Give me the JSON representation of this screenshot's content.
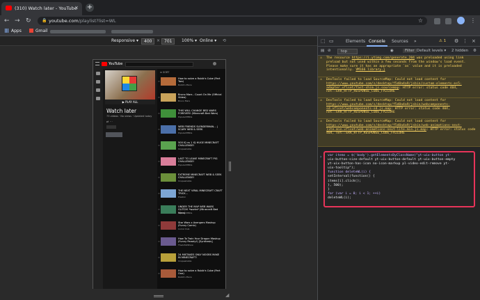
{
  "browser": {
    "tab_title": "(310) Watch later - YouTube",
    "tab_close": "×",
    "new_tab": "+",
    "back": "←",
    "forward": "→",
    "reload": "↻",
    "lock": "🔒",
    "url_host": "youtube.com",
    "url_path": "/playlist?list=WL",
    "star": "☆",
    "menu": "⋮"
  },
  "bookmarks": {
    "apps": "Apps",
    "gmail": "Gmail"
  },
  "device_toolbar": {
    "device": "Responsive ▾",
    "width": "400",
    "times": "×",
    "height": "701",
    "zoom": "100% ▾",
    "network": "Online ▾"
  },
  "youtube": {
    "logo_text": "YouTube",
    "play_all": "▶ PLAY ALL",
    "playlist_title": "Watch later",
    "playlist_meta": "73 videos · No views · Updated today",
    "sort_label": "≡ SORT",
    "videos": [
      {
        "title": "How to solve a Rubik's Cube (Part Two)",
        "channel": "Rubik's Place",
        "color": "#b56b3a"
      },
      {
        "title": "Bruno Mars - Count On Me (Official Video)",
        "channel": "Bruno Mars",
        "color": "#c9a35a"
      },
      {
        "title": "THIS WILL CHANGE BED WARS FOREVER! (Minecraft Bed Wars)",
        "channel": "PopularMMOs",
        "color": "#3f8f3a"
      },
      {
        "title": "WEB FRIENDS SLENDERMAN... | SCARY WEB & SEEK",
        "channel": "PopularMMOs",
        "color": "#4b6fa8"
      },
      {
        "title": "500 IQ vs 1 IQ HUGE MINECRAFT CHALLENGE!",
        "channel": "Unspeakable",
        "color": "#5aa34f"
      },
      {
        "title": "LAST TO LEAVE MINECRAFT PIG CHALLENGE!",
        "channel": "PopularMMOs",
        "color": "#d97e9a"
      },
      {
        "title": "EXTREME MINECRAFT WEB & SEEK CHALLENGE!",
        "channel": "Unspeakable",
        "color": "#6b8f3a"
      },
      {
        "title": "THE NEXT VIRAL MINECRAFT CRAFT TRICK...",
        "channel": "Preston",
        "color": "#7da6d4"
      },
      {
        "title": "UNDER THE MAP WEB WARS GLITCH! *works* (Minecraft Bed Wars)",
        "channel": "PopularMMOs",
        "color": "#3a7d5a"
      },
      {
        "title": "Star Wars x Avengers Mashup (Funny Comic)",
        "channel": "Comic Dub",
        "color": "#8f3a3a"
      },
      {
        "title": "How To Train Your Dragon Mashup (Funny Parody!) [Synthesis]",
        "channel": "TheArtistShow",
        "color": "#6a5a8f"
      },
      {
        "title": "24 MISTAKES ONLY NOOBS MAKE IN MINECRAFT!",
        "channel": "Unspeakable",
        "color": "#b8a03a"
      },
      {
        "title": "How to solve a Rubik's Cube (Part One)",
        "channel": "Rubik's Place",
        "color": "#a85a3a"
      }
    ]
  },
  "devtools": {
    "tabs": [
      "Elements",
      "Console",
      "Sources",
      "»"
    ],
    "warn_count": "1",
    "context": "top",
    "filter_placeholder": "Filter",
    "levels": "Default levels ▾",
    "hidden": "2 hidden",
    "messages": [
      {
        "pre": "The resource ",
        "link": "https://i.ytimg.com/generate_204",
        "post": " was preloaded using link preload but not used within a few seconds from the window's load event. Please make sure it has an appropriate `as` value and it is preloaded intentionally.",
        "src": "VM166 library.j"
      },
      {
        "pre": "DevTools failed to load SourceMap: Could not load content for ",
        "link": "https://www.youtube.com/s/desktop/f5d8a4a9/jsbin/custom-elements-es5-adapter.vflset/fast-shim.js.sourcemap",
        "post": ": HTTP error: status code 404, net::ERR_HTTP_RESPONSE_CODE_FAILURE",
        "src": ""
      },
      {
        "pre": "DevTools failed to load SourceMap: Could not load content for ",
        "link": "https://www.youtube.com/s/desktop/f5d8a4a9/jsbin/webcomponents-sd.vflset/webcomponents-sd.js.map",
        "post": ": HTTP error: status code 404, net::ERR_HTTP_RESPONSE_CODE_FAILURE",
        "src": ""
      },
      {
        "pre": "DevTools failed to load SourceMap: Could not load content for ",
        "link": "https://www.youtube.com/s/desktop/f5d8a4a9/jsbin/web-animations-next-lite.min.vflset/web-animations-next-lite.min.js.map",
        "post": ": HTTP error: status code 404, net::ERR_HTTP_RESPONSE_CODE_FAILURE",
        "src": ""
      }
    ],
    "prompt": "›",
    "code_lines": [
      "var items = $('body').getElementsByClassName(\"yt-uix-button yt-",
      "uix-button-size-default yt-uix-button-default yt-uix-button-empty",
      "yt-uix-button-has-icon no-icon-markup pl-video-edit-remove yt-",
      "uix-tooltip\");",
      "function deleteWL(i) {",
      "setInterval(function() {",
      "items[i].click();",
      "}, 500);",
      "}",
      "for (var i = 0; i < 1; ++i)",
      "deleteWL(i);"
    ]
  }
}
